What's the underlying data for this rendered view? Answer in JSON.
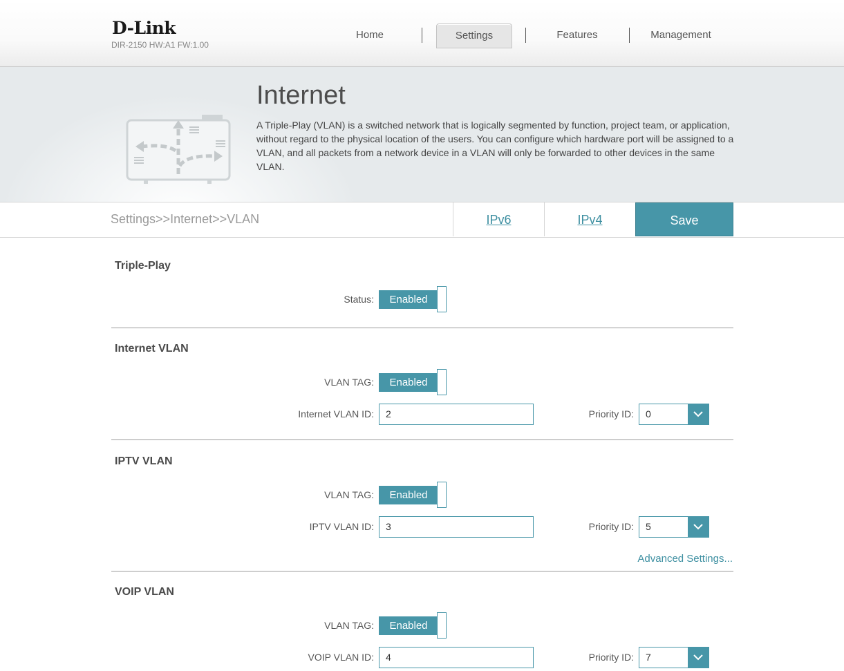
{
  "header": {
    "logo": "D-Link",
    "model": "DIR-2150 HW:A1 FW:1.00",
    "nav": [
      {
        "label": "Home",
        "active": false
      },
      {
        "label": "Settings",
        "active": true
      },
      {
        "label": "Features",
        "active": false
      },
      {
        "label": "Management",
        "active": false
      }
    ]
  },
  "hero": {
    "title": "Internet",
    "description": "A Triple-Play (VLAN) is a switched network that is logically segmented by function, project team, or application, without regard to the physical location of the users. You can configure which hardware port will be assigned to a VLAN, and all packets from a network device in a VLAN will only be forwarded to other devices in the same VLAN.",
    "icon": "network-routing-icon"
  },
  "toolbar": {
    "breadcrumb": "Settings>>Internet>>VLAN",
    "tabs": [
      "IPv6",
      "IPv4"
    ],
    "save_label": "Save"
  },
  "sections": {
    "triple_play": {
      "title": "Triple-Play",
      "status_label": "Status:",
      "status_value": "Enabled"
    },
    "internet_vlan": {
      "title": "Internet VLAN",
      "tag_label": "VLAN TAG:",
      "tag_value": "Enabled",
      "id_label": "Internet VLAN ID:",
      "id_value": "2",
      "priority_label": "Priority ID:",
      "priority_value": "0"
    },
    "iptv_vlan": {
      "title": "IPTV VLAN",
      "tag_label": "VLAN TAG:",
      "tag_value": "Enabled",
      "id_label": "IPTV VLAN ID:",
      "id_value": "3",
      "priority_label": "Priority ID:",
      "priority_value": "5",
      "advanced_link": "Advanced Settings..."
    },
    "voip_vlan": {
      "title": "VOIP VLAN",
      "tag_label": "VLAN TAG:",
      "tag_value": "Enabled",
      "id_label": "VOIP VLAN ID:",
      "id_value": "4",
      "priority_label": "Priority ID:",
      "priority_value": "7"
    }
  },
  "colors": {
    "accent": "#4796a8",
    "link": "#3d8fa1"
  }
}
